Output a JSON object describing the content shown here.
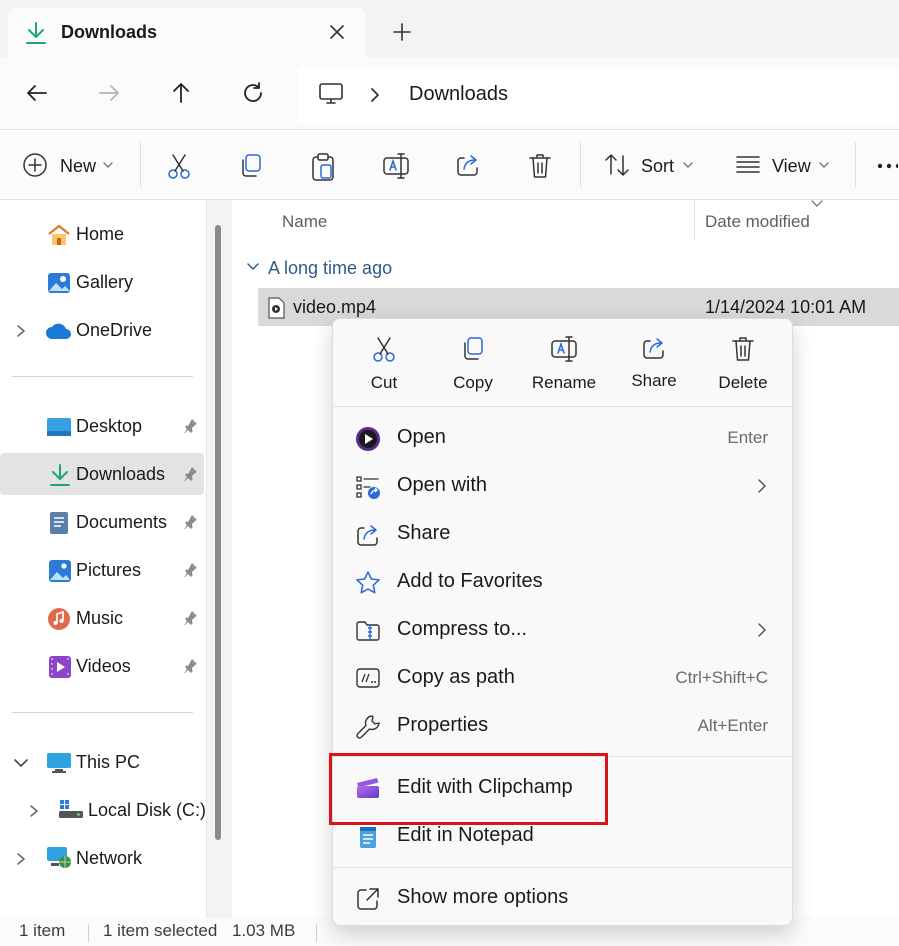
{
  "window": {
    "tab_title": "Downloads",
    "tab_icon": "download-icon",
    "new_tab_icon": "plus-icon",
    "close_icon": "close-icon"
  },
  "navigation": {
    "back_icon": "back-arrow-icon",
    "forward_icon": "forward-arrow-icon",
    "up_icon": "up-arrow-icon",
    "refresh_icon": "refresh-icon",
    "address": {
      "root_icon": "this-pc-icon",
      "crumb": "Downloads"
    }
  },
  "commandbar": {
    "new_label": "New",
    "sort_label": "Sort",
    "view_label": "View",
    "actions": [
      "cut-icon",
      "copy-icon",
      "paste-icon",
      "rename-icon",
      "share-icon",
      "delete-icon"
    ]
  },
  "sidebar": {
    "home": "Home",
    "gallery": "Gallery",
    "onedrive": "OneDrive",
    "desktop": "Desktop",
    "downloads": "Downloads",
    "documents": "Documents",
    "pictures": "Pictures",
    "music": "Music",
    "videos": "Videos",
    "this_pc": "This PC",
    "local_disk": "Local Disk (C:)",
    "network": "Network"
  },
  "filelist": {
    "col_name": "Name",
    "col_date": "Date modified",
    "group_label": "A long time ago",
    "file_name": "video.mp4",
    "file_date": "1/14/2024 10:01 AM"
  },
  "status": {
    "count": "1 item",
    "selected": "1 item selected",
    "size": "1.03 MB"
  },
  "context_menu": {
    "quick_actions": {
      "cut": "Cut",
      "copy": "Copy",
      "rename": "Rename",
      "share": "Share",
      "delete": "Delete"
    },
    "open": "Open",
    "open_shortcut": "Enter",
    "open_with": "Open with",
    "share": "Share",
    "add_favorites": "Add to Favorites",
    "compress": "Compress to...",
    "copy_path": "Copy as path",
    "copy_path_shortcut": "Ctrl+Shift+C",
    "properties": "Properties",
    "properties_shortcut": "Alt+Enter",
    "clipchamp": "Edit with Clipchamp",
    "notepad": "Edit in Notepad",
    "more_options": "Show more options"
  },
  "colors": {
    "highlight_border": "#d9141b",
    "accent_download": "#1fa37a",
    "selection_bg": "#d9d9d9",
    "group_text": "#2c5d8a"
  }
}
